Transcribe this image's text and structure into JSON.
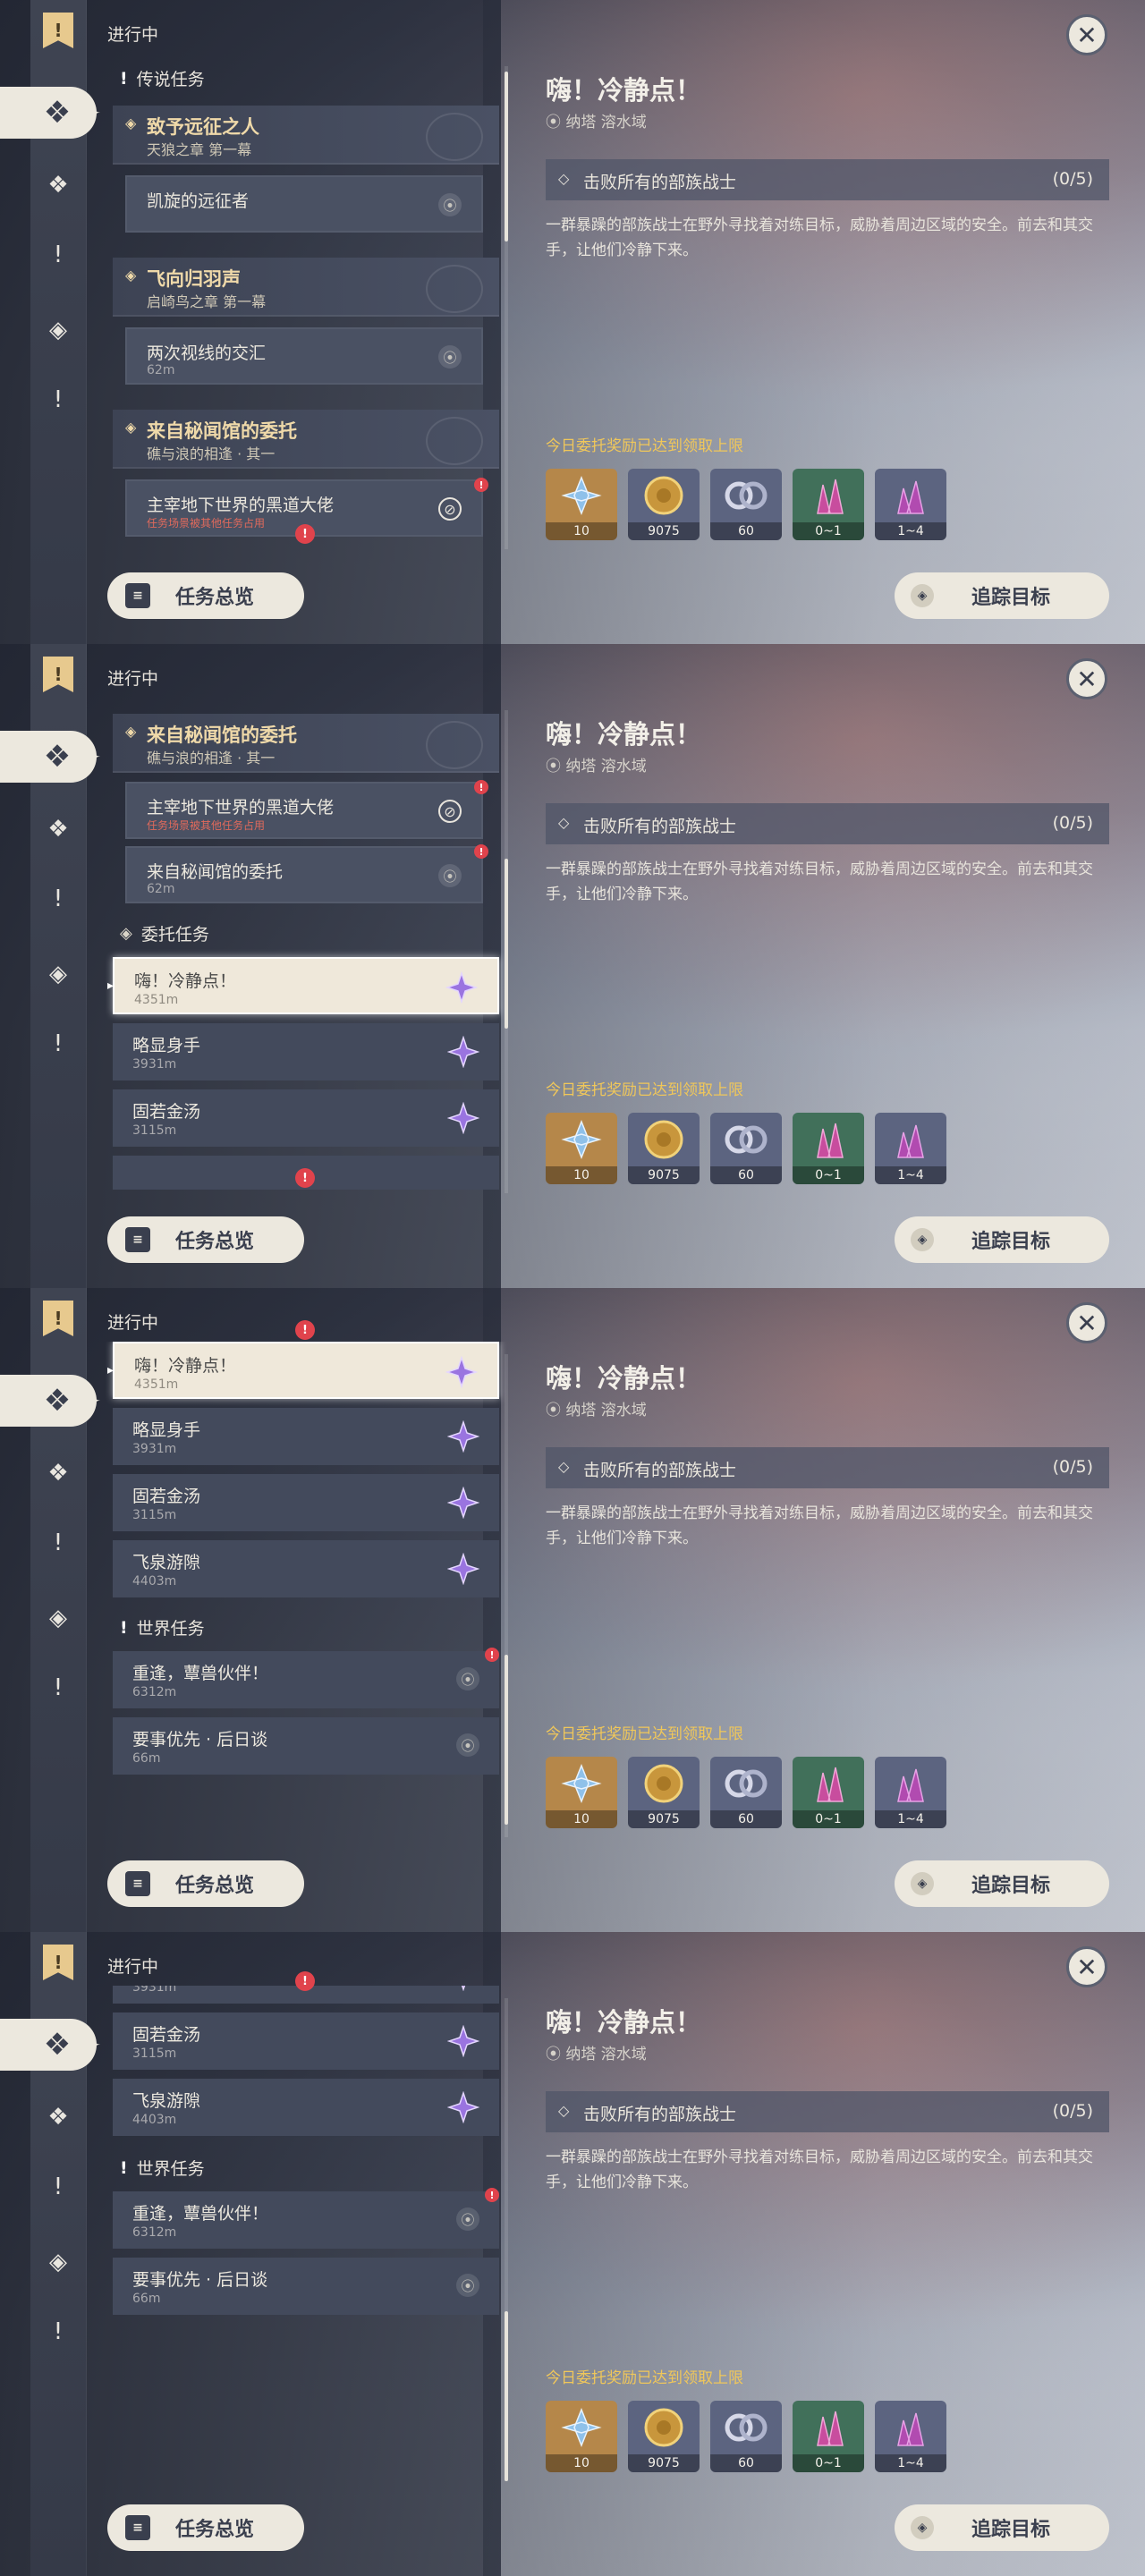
{
  "header": {
    "status": "进行中",
    "close": "✕"
  },
  "rail_icons": {
    "top": "quest-book-icon",
    "items": [
      "archon-quest-icon",
      "story-quest-icon",
      "world-quest-icon",
      "commission-icon",
      "event-quest-icon"
    ]
  },
  "sections": {
    "legend_title": "传说任务",
    "commission_title": "委托任务",
    "world_title": "世界任务"
  },
  "archon_quests": [
    {
      "title": "致予远征之人",
      "subtitle": "天狼之章 第一幕",
      "task": "凯旋的远征者",
      "distance": ""
    },
    {
      "title": "飞向归羽声",
      "subtitle": "启崎鸟之章 第一幕",
      "task": "两次视线的交汇",
      "distance": "62m"
    },
    {
      "title": "来自秘闻馆的委托",
      "subtitle": "礁与浪的相逢 · 其一",
      "task": "主宰地下世界的黑道大佬",
      "warning": "任务场景被其他任务占用",
      "task2": "来自秘闻馆的委托",
      "distance2": "62m"
    }
  ],
  "commissions": [
    {
      "name": "嗨！冷静点！",
      "distance": "4351m"
    },
    {
      "name": "略显身手",
      "distance": "3931m"
    },
    {
      "name": "固若金汤",
      "distance": "3115m"
    },
    {
      "name": "飞泉游隙",
      "distance": "4403m"
    }
  ],
  "world_quests": [
    {
      "name": "重逢，蕈兽伙伴！",
      "distance": "6312m"
    },
    {
      "name": "要事优先 · 后日谈",
      "distance": "66m"
    }
  ],
  "detail": {
    "title": "嗨！冷静点！",
    "location": "纳塔 溶水域",
    "objective": "击败所有的部族战士",
    "progress": "(0/5)",
    "description": "一群暴躁的部族战士在野外寻找着对练目标，威胁着周边区域的安全。前去和其交手，让他们冷静下来。",
    "reward_limit": "今日委托奖励已达到领取上限",
    "rewards": [
      {
        "icon": "primogem-icon",
        "count": "10",
        "color": "#b5874a"
      },
      {
        "icon": "mora-icon",
        "count": "9075",
        "color": "#5c6480"
      },
      {
        "icon": "companionship-exp-icon",
        "count": "60",
        "color": "#5c6480"
      },
      {
        "icon": "ore-crystal-icon",
        "count": "0~1",
        "color": "#41705a"
      },
      {
        "icon": "mystic-ore-icon",
        "count": "1~4",
        "color": "#5c6480"
      }
    ]
  },
  "buttons": {
    "overview": "任务总览",
    "track": "追踪目标"
  }
}
